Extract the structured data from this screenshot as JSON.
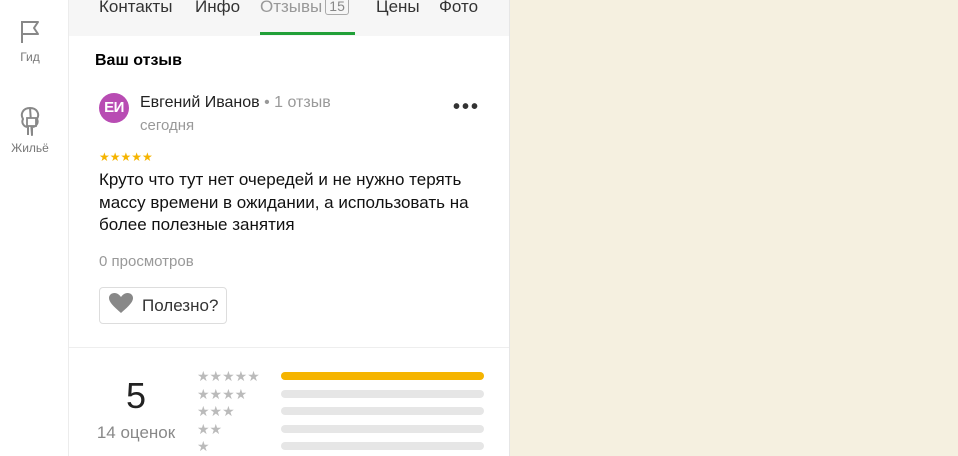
{
  "sidebar": {
    "items": [
      {
        "label": "Гид",
        "icon": "flag-icon"
      },
      {
        "label": "Жильё",
        "icon": "tree-house-icon"
      }
    ]
  },
  "tabs": [
    {
      "label": "Контакты"
    },
    {
      "label": "Инфо"
    },
    {
      "label": "Отзывы",
      "count": "15",
      "active": true
    },
    {
      "label": "Цены"
    },
    {
      "label": "Фото"
    }
  ],
  "review": {
    "section_title": "Ваш отзыв",
    "avatar_initials": "ЕИ",
    "author": "Евгений Иванов",
    "author_meta": " • 1 отзыв",
    "date": "сегодня",
    "stars": "★★★★★",
    "rating": 5,
    "text": "Круто что тут нет очередей и не нужно терять массу времени в ожидании, а использовать на более полезные занятия",
    "views": "0 просмотров",
    "useful_label": "Полезно?",
    "more_label": "•••"
  },
  "rating_summary": {
    "average": "5",
    "count_label": "14 оценок",
    "distribution": [
      {
        "stars": "★★★★★",
        "fraction": 1.0
      },
      {
        "stars": "★★★★",
        "fraction": 0.0
      },
      {
        "stars": "★★★",
        "fraction": 0.0
      },
      {
        "stars": "★★",
        "fraction": 0.0
      },
      {
        "stars": "★",
        "fraction": 0.0
      }
    ]
  },
  "colors": {
    "accent_green": "#21a038",
    "star_yellow": "#f5b400",
    "avatar_purple": "#b84cb3",
    "map_background": "#f5f0e0"
  }
}
